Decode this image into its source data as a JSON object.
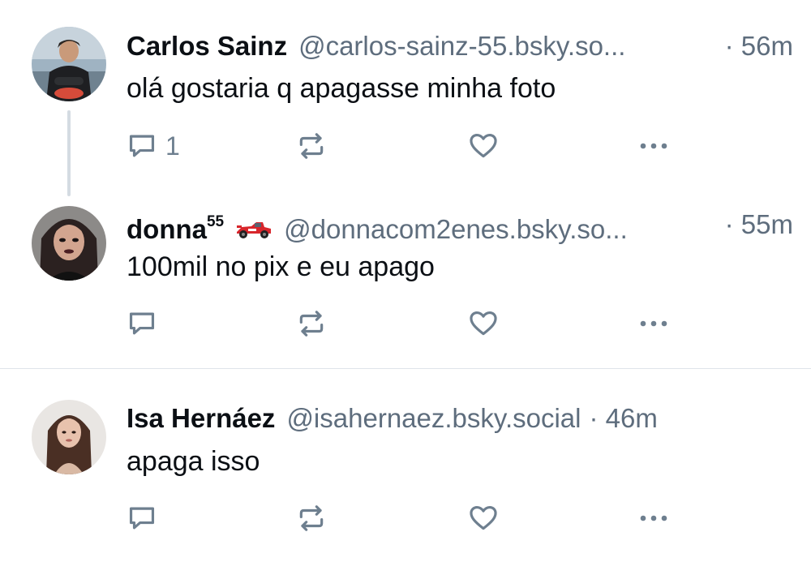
{
  "posts": [
    {
      "name": "Carlos Sainz",
      "handle": "@carlos-sainz-55.bsky.so...",
      "time": "· 56m",
      "text": "olá gostaria q apagasse minha foto",
      "reply_count": "1",
      "avatar_icon": "avatar-carlos"
    },
    {
      "name": "donna",
      "name_sup": "55",
      "emoji_icon": "race-car-icon",
      "handle": "@donnacom2enes.bsky.so...",
      "time": "· 55m",
      "text": "100mil no pix e eu apago",
      "reply_count": "",
      "avatar_icon": "avatar-donna"
    },
    {
      "name": "Isa Hernáez",
      "handle": "@isahernaez.bsky.social",
      "time": "· 46m",
      "text": "apaga isso",
      "reply_count": "",
      "avatar_icon": "avatar-isa"
    }
  ],
  "colors": {
    "text": "#0b0f14",
    "muted": "#5e6d7d",
    "icon": "#6e7f8f",
    "thread_line": "#d4dbe2",
    "divider": "#dfe4ea"
  }
}
